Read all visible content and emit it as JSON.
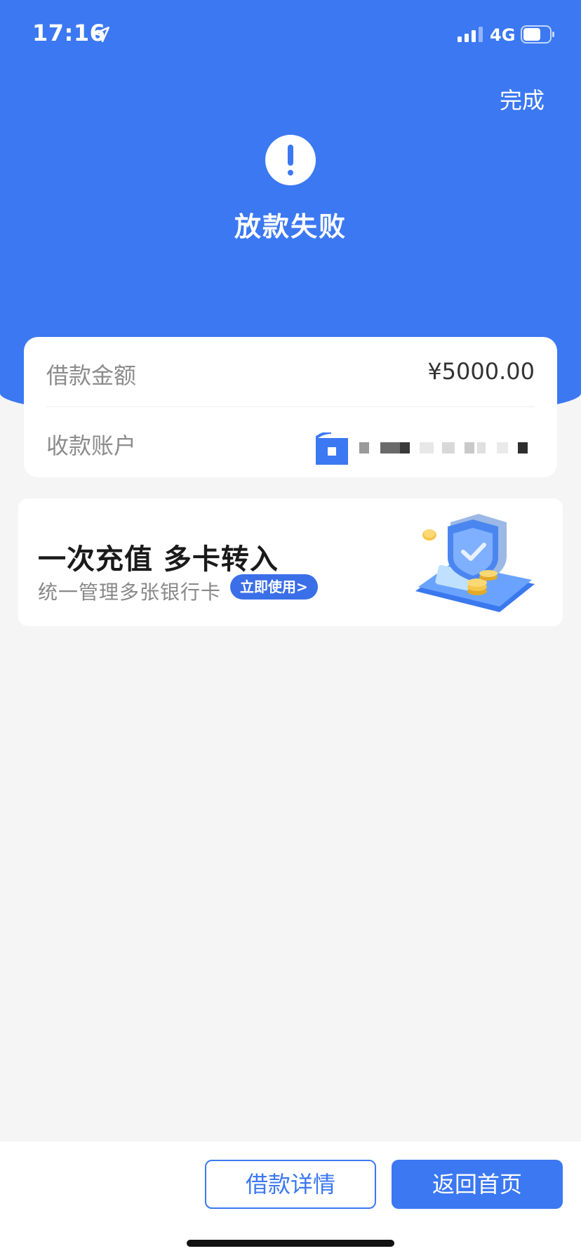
{
  "status_bar": {
    "time": "17:16",
    "network": "4G"
  },
  "header": {
    "done_label": "完成",
    "status_title": "放款失败"
  },
  "loan_info": {
    "amount_label": "借款金额",
    "amount_value": "¥5000.00",
    "account_label": "收款账户"
  },
  "promo": {
    "title": "一次充值 多卡转入",
    "subtitle": "统一管理多张银行卡",
    "cta_label": "立即使用>"
  },
  "actions": {
    "details_label": "借款详情",
    "home_label": "返回首页"
  },
  "colors": {
    "primary": "#3b78f2",
    "background": "#f5f5f5"
  }
}
